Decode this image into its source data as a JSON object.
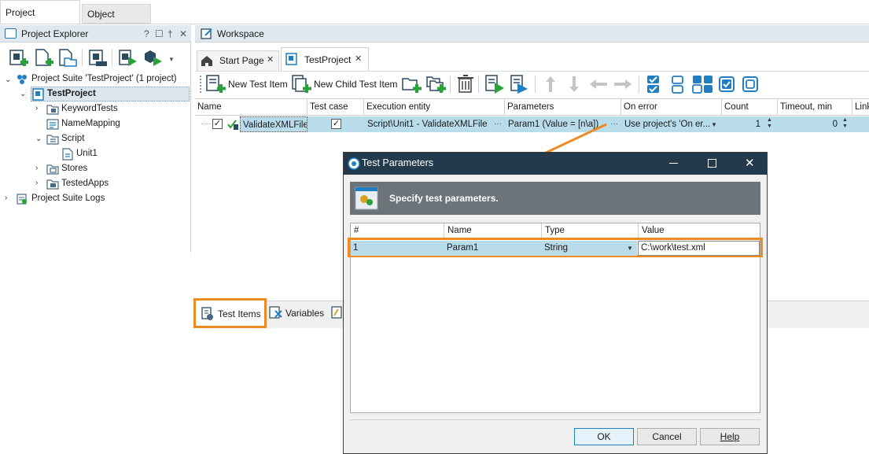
{
  "workspace_tabs": {
    "project_workspace": "Project Workspace",
    "object_browser": "Object Browser"
  },
  "explorer": {
    "title": "Project Explorer",
    "controls": {
      "help": "?",
      "restore": "☐",
      "pin": "†",
      "close": "✕"
    },
    "tree": {
      "suite": "Project Suite 'TestProject' (1 project)",
      "project": "TestProject",
      "keyword_tests": "KeywordTests",
      "name_mapping": "NameMapping",
      "script": "Script",
      "unit1": "Unit1",
      "stores": "Stores",
      "tested_apps": "TestedApps",
      "logs": "Project Suite Logs"
    }
  },
  "workspace": {
    "title": "Workspace",
    "tabs": [
      "Start Page",
      "TestProject"
    ],
    "toolbar": {
      "new_test_item": "New Test Item",
      "new_child_test_item": "New Child Test Item"
    },
    "grid": {
      "columns": [
        "Name",
        "Test case",
        "Execution entity",
        "Parameters",
        "On error",
        "Count",
        "Timeout, min",
        "Link"
      ],
      "row": {
        "name": "ValidateXMLFile",
        "execution_entity": "Script\\Unit1 - ValidateXMLFile",
        "parameters": "Param1 (Value = [n\\a])",
        "on_error": "Use project's 'On er...",
        "count": "1",
        "timeout": "0",
        "ellipsis": "···"
      }
    },
    "bottom_tabs": {
      "test_items": "Test Items",
      "variables": "Variables"
    }
  },
  "dialog": {
    "title": "Test Parameters",
    "banner": "Specify test parameters.",
    "columns": [
      "#",
      "Name",
      "Type",
      "Value"
    ],
    "row": {
      "index": "1",
      "name": "Param1",
      "type": "String",
      "value": "C:\\work\\test.xml"
    },
    "buttons": {
      "ok": "OK",
      "cancel": "Cancel",
      "help": "Help"
    }
  },
  "colors": {
    "accent_highlight": "#ee8a22",
    "selection": "#b8dcea",
    "dialog_title_bar": "#223a4b",
    "banner_bg": "#6d7479"
  }
}
